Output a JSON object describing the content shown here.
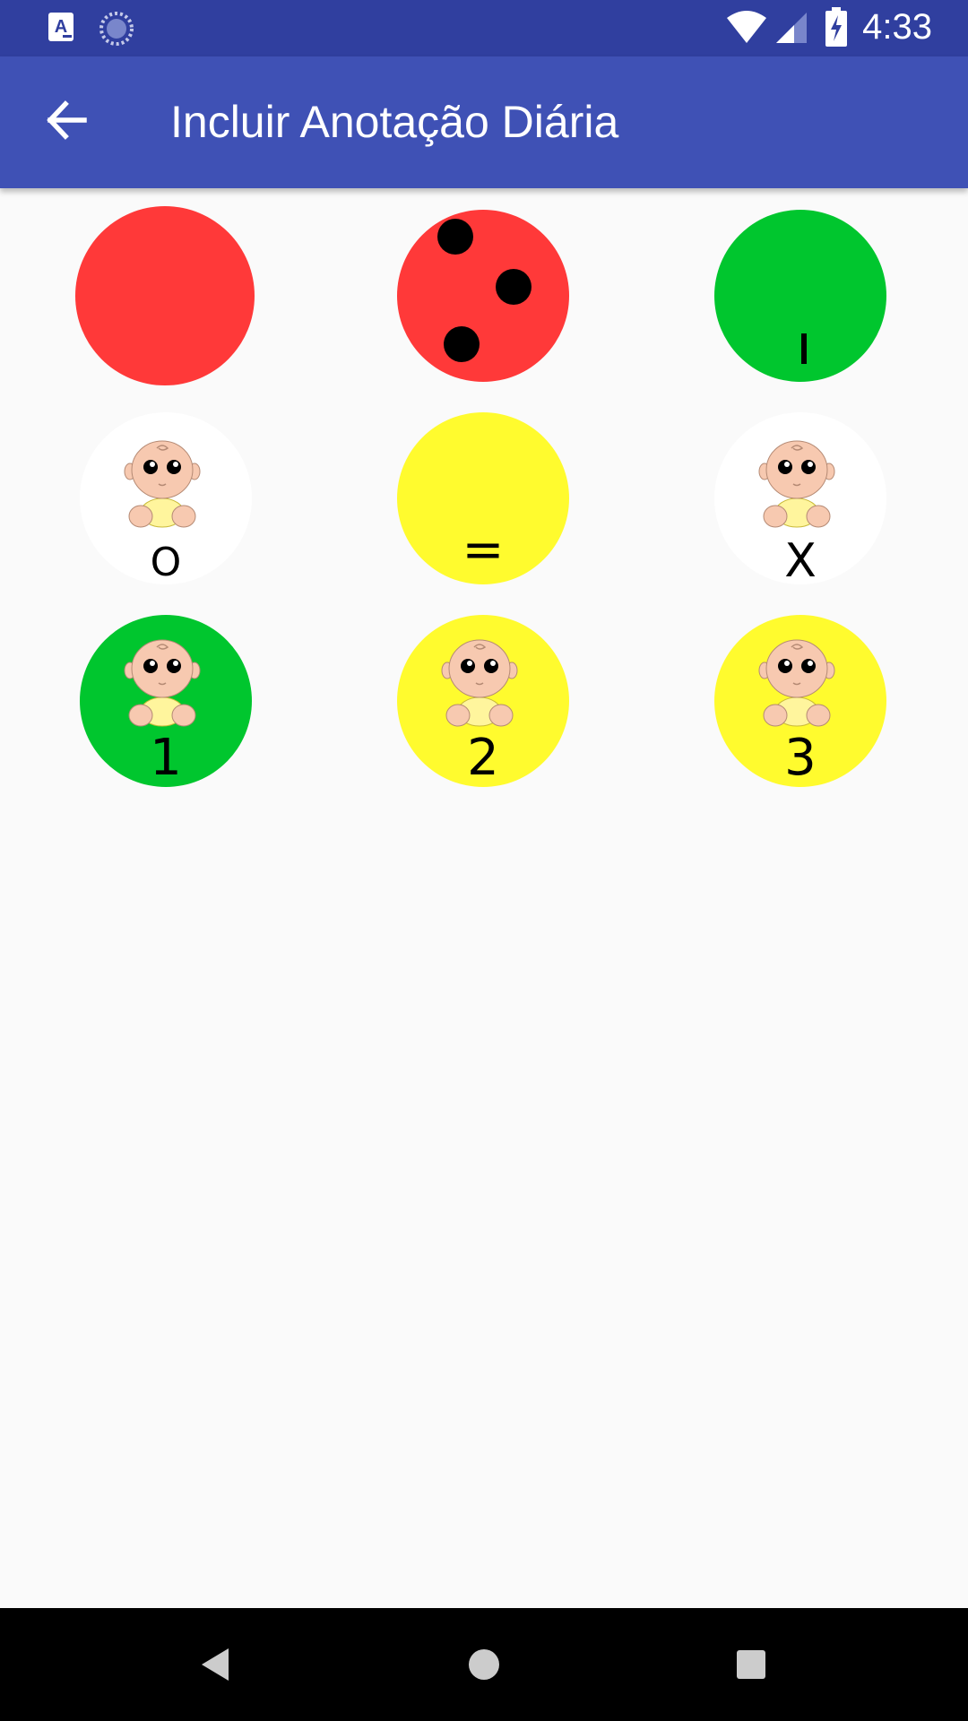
{
  "status_bar": {
    "time": "4:33"
  },
  "app_bar": {
    "title": "Incluir Anotação Diária",
    "back_icon": "arrow-back-icon"
  },
  "colors": {
    "status_bar": "#303F9F",
    "app_bar": "#3F51B5",
    "red": "#FF3939",
    "green": "#00C62E",
    "yellow": "#FFFB2E",
    "white": "#FFFFFF"
  },
  "cells": [
    {
      "name": "cell-red-plain",
      "color": "red",
      "label": "",
      "baby": false
    },
    {
      "name": "cell-red-dots",
      "color": "red",
      "label": "",
      "baby": false,
      "icon": "three-dots-icon"
    },
    {
      "name": "cell-green-bar",
      "color": "green",
      "label": "I",
      "baby": false
    },
    {
      "name": "cell-white-o",
      "color": "white",
      "label": "O",
      "baby": true
    },
    {
      "name": "cell-yellow-equals",
      "color": "yellow",
      "label": "=",
      "baby": false
    },
    {
      "name": "cell-white-x",
      "color": "white",
      "label": "X",
      "baby": true
    },
    {
      "name": "cell-green-1",
      "color": "green",
      "label": "1",
      "baby": true
    },
    {
      "name": "cell-yellow-2",
      "color": "yellow",
      "label": "2",
      "baby": true
    },
    {
      "name": "cell-yellow-3",
      "color": "yellow",
      "label": "3",
      "baby": true
    }
  ],
  "nav_bar": {
    "back_icon": "nav-back-triangle-icon",
    "home_icon": "nav-home-circle-icon",
    "recents_icon": "nav-recents-square-icon"
  }
}
